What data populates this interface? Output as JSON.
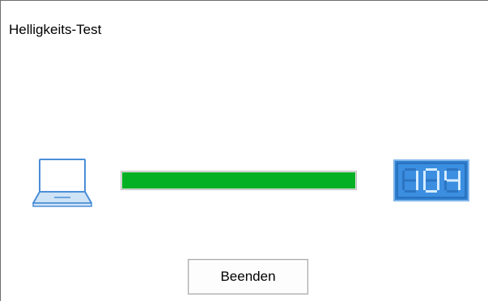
{
  "window": {
    "title": "Helligkeits-Test"
  },
  "icons": {
    "device": "laptop-icon",
    "display": "digital-display-icon"
  },
  "brightness": {
    "value_display": "104",
    "level_fraction": 1.0
  },
  "actions": {
    "quit_label": "Beenden"
  },
  "colors": {
    "progress_fill": "#06b025",
    "icon_blue": "#4a8ed6",
    "display_bg": "#2f7fd0",
    "display_digit": "#d6ecff"
  }
}
